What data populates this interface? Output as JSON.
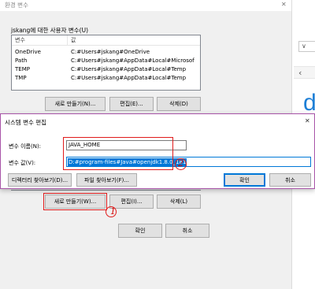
{
  "env_window": {
    "title": "환경 변수",
    "close_glyph": "✕",
    "user_section_label": "jskang에 대한 사용자 변수(U)",
    "table_headers": [
      "변수",
      "값"
    ],
    "user_vars": [
      {
        "name": "OneDrive",
        "value": "C:#Users#jskang#OneDrive"
      },
      {
        "name": "Path",
        "value": "C:#Users#jskang#AppData#Local#Microsoft..."
      },
      {
        "name": "TEMP",
        "value": "C:#Users#jskang#AppData#Local#Temp"
      },
      {
        "name": "TMP",
        "value": "C:#Users#jskang#AppData#Local#Temp"
      }
    ],
    "user_buttons": {
      "new": "새로 만들기(N)...",
      "edit": "편집(E)...",
      "delete": "삭제(D)"
    },
    "system_buttons": {
      "new": "새로 만들기(W)...",
      "edit": "편집(I)...",
      "delete": "삭제(L)"
    },
    "ok": "확인",
    "cancel": "취소"
  },
  "edit_dialog": {
    "title": "시스템 변수 편집",
    "close_glyph": "✕",
    "name_label": "변수 이름(N):",
    "name_value": "JAVA_HOME",
    "value_label": "변수 값(V):",
    "value_value": "D:#program-files#Java#openjdk1.8.0_181",
    "browse_dir": "디렉터리 찾아보기(D)...",
    "browse_file": "파일 찾아보기(F)...",
    "ok": "확인",
    "cancel": "취소"
  },
  "annotations": {
    "mark_1": "1",
    "mark_2": "2"
  },
  "background_fragments": {
    "dropdown_glyph": "∨",
    "chevron_glyph": "‹",
    "letter": "d"
  },
  "colors": {
    "accent": "#0078d7",
    "annotation_red": "#e01b1b",
    "selection": "#0078d7"
  }
}
